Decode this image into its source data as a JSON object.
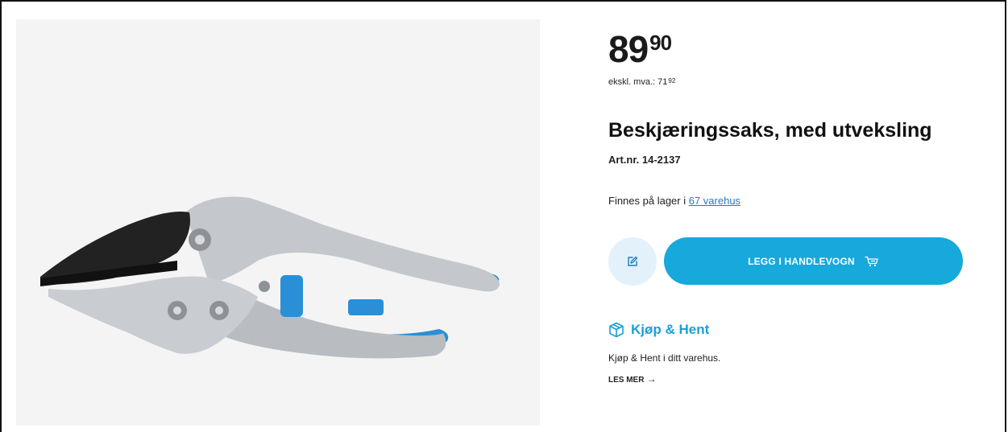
{
  "product": {
    "image_alt": "Beskjæringssaks med utveksling",
    "price_main": "89",
    "price_cents": "90",
    "ex_vat_label": "ekskl. mva.:",
    "ex_vat_main": "71",
    "ex_vat_cents": "92",
    "title": "Beskjæringssaks, med utveksling",
    "art_nr": "Art.nr. 14-2137",
    "stock_prefix": "Finnes på lager i ",
    "stock_link": "67 varehus"
  },
  "actions": {
    "edit_icon": "edit-icon",
    "cart_label": "LEGG I HANDLEVOGN",
    "cart_icon": "cart-icon"
  },
  "kjop_hent": {
    "icon": "box-icon",
    "title": "Kjøp & Hent",
    "description": "Kjøp & Hent i ditt varehus.",
    "link_label": "LES MER",
    "link_arrow": "→"
  },
  "colors": {
    "accent": "#17a8dc",
    "accent_light": "#e3f1fb",
    "link": "#1a7fbf",
    "handle_blue": "#2a8fd6"
  }
}
